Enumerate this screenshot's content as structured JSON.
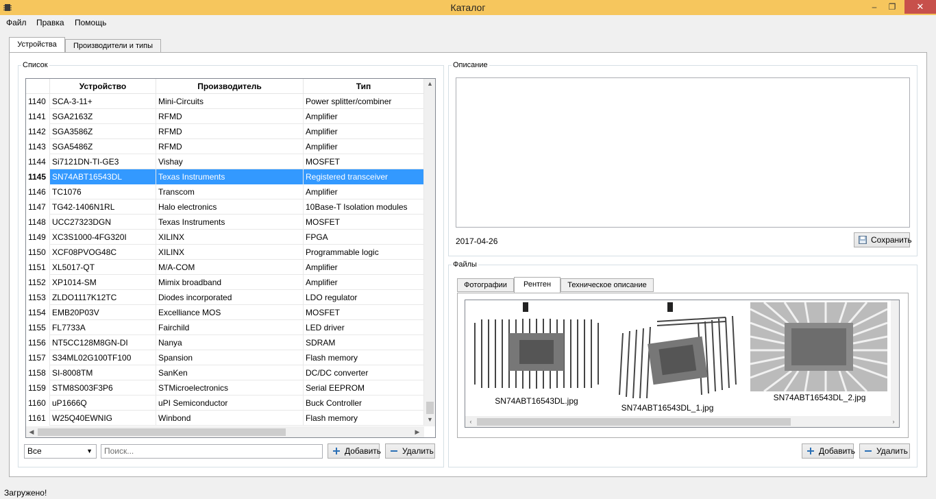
{
  "window": {
    "title": "Каталог",
    "minimize": "‒",
    "restore": "❐",
    "close": "✕"
  },
  "menu": [
    "Файл",
    "Правка",
    "Помощь"
  ],
  "main_tabs": [
    "Устройства",
    "Производители и типы"
  ],
  "list": {
    "label": "Список",
    "columns": [
      "Устройство",
      "Производитель",
      "Тип"
    ],
    "selected_index": 5,
    "rows": [
      [
        "1140",
        "SCA-3-11+",
        "Mini-Circuits",
        "Power splitter/combiner"
      ],
      [
        "1141",
        "SGA2163Z",
        "RFMD",
        "Amplifier"
      ],
      [
        "1142",
        "SGA3586Z",
        "RFMD",
        "Amplifier"
      ],
      [
        "1143",
        "SGA5486Z",
        "RFMD",
        "Amplifier"
      ],
      [
        "1144",
        "Si7121DN-TI-GE3",
        "Vishay",
        "MOSFET"
      ],
      [
        "1145",
        "SN74ABT16543DL",
        "Texas Instruments",
        "Registered transceiver"
      ],
      [
        "1146",
        "TC1076",
        "Transcom",
        "Amplifier"
      ],
      [
        "1147",
        "TG42-1406N1RL",
        "Halo electronics",
        "10Base-T Isolation modules"
      ],
      [
        "1148",
        "UCC27323DGN",
        "Texas Instruments",
        "MOSFET"
      ],
      [
        "1149",
        "XC3S1000-4FG320I",
        "XILINX",
        "FPGA"
      ],
      [
        "1150",
        "XCF08PVOG48C",
        "XILINX",
        "Programmable logic"
      ],
      [
        "1151",
        "XL5017-QT",
        "M/A-COM",
        "Amplifier"
      ],
      [
        "1152",
        "XP1014-SM",
        "Mimix broadband",
        "Amplifier"
      ],
      [
        "1153",
        "ZLDO1117K12TC",
        "Diodes incorporated",
        "LDO regulator"
      ],
      [
        "1154",
        "EMB20P03V",
        "Excelliance MOS",
        "MOSFET"
      ],
      [
        "1155",
        "FL7733A",
        "Fairchild",
        "LED driver"
      ],
      [
        "1156",
        "NT5CC128M8GN-DI",
        "Nanya",
        "SDRAM"
      ],
      [
        "1157",
        "S34ML02G100TF100",
        "Spansion",
        "Flash memory"
      ],
      [
        "1158",
        "SI-8008TM",
        "SanKen",
        "DC/DC converter"
      ],
      [
        "1159",
        "STM8S003F3P6",
        "STMicroelectronics",
        "Serial EEPROM"
      ],
      [
        "1160",
        "uP1666Q",
        "uPI Semiconductor",
        "Buck Controller"
      ],
      [
        "1161",
        "W25Q40EWNIG",
        "Winbond",
        "Flash memory"
      ]
    ]
  },
  "filter": {
    "selected": "Все",
    "search_placeholder": "Поиск...",
    "add_label": "Добавить",
    "delete_label": "Удалить"
  },
  "description": {
    "label": "Описание",
    "text": "",
    "date": "2017-04-26",
    "save_label": "Сохранить"
  },
  "files": {
    "label": "Файлы",
    "tabs": [
      "Фотографии",
      "Рентген",
      "Техническое описание"
    ],
    "active_tab": 1,
    "images": [
      "SN74ABT16543DL.jpg",
      "SN74ABT16543DL_1.jpg",
      "SN74ABT16543DL_2.jpg"
    ],
    "add_label": "Добавить",
    "delete_label": "Удалить"
  },
  "status": "Загружено!",
  "colors": {
    "titlebar": "#f6c65d",
    "selection": "#3399ff",
    "close": "#c7504b"
  },
  "icons": [
    "app-icon",
    "plus-icon",
    "minus-icon",
    "save-icon",
    "chevron-down-icon"
  ]
}
